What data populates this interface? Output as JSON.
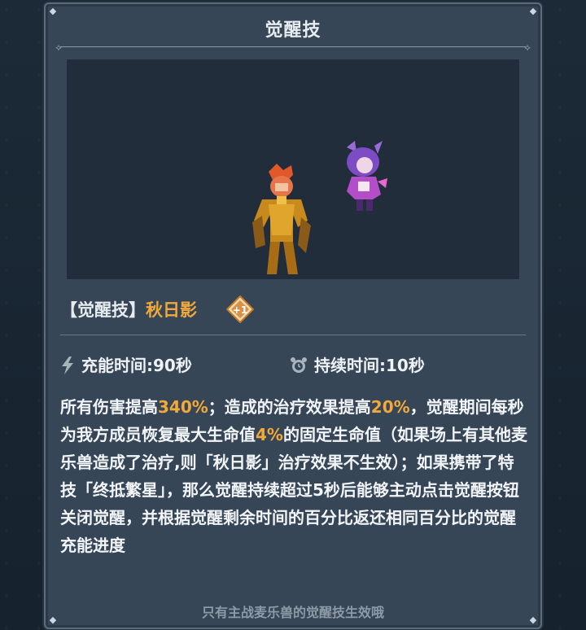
{
  "panel": {
    "title": "觉醒技"
  },
  "skill": {
    "tag": "【觉醒技】",
    "name": "秋日影",
    "badge": "+1"
  },
  "stats": {
    "charge": "充能时间:90秒",
    "duration": "持续时间:10秒"
  },
  "description": {
    "p1": "所有伤害提高",
    "v1": "340%",
    "p2": "；造成的治疗效果提高",
    "v2": "20%",
    "p3": "，觉醒期间每秒为我方成员恢复最大生命值",
    "v3": "4%",
    "p4": "的固定生命值（如果场上有其他麦乐兽造成了治疗,则「秋日影」治疗效果不生效）；如果携带了特技「终抵繁星」，那么觉醒持续超过5秒后能够主动点击觉醒按钮关闭觉醒，并根据觉醒剩余时间的百分比返还相同百分比的觉醒充能进度"
  },
  "footer": "只有主战麦乐兽的觉醒技生效哦",
  "colors": {
    "accent": "#f0a93a",
    "panel": "#364656",
    "scene_bg": "#222d3c"
  },
  "icons": [
    "lightning-icon",
    "alarm-clock-icon",
    "plus-one-badge-icon"
  ]
}
